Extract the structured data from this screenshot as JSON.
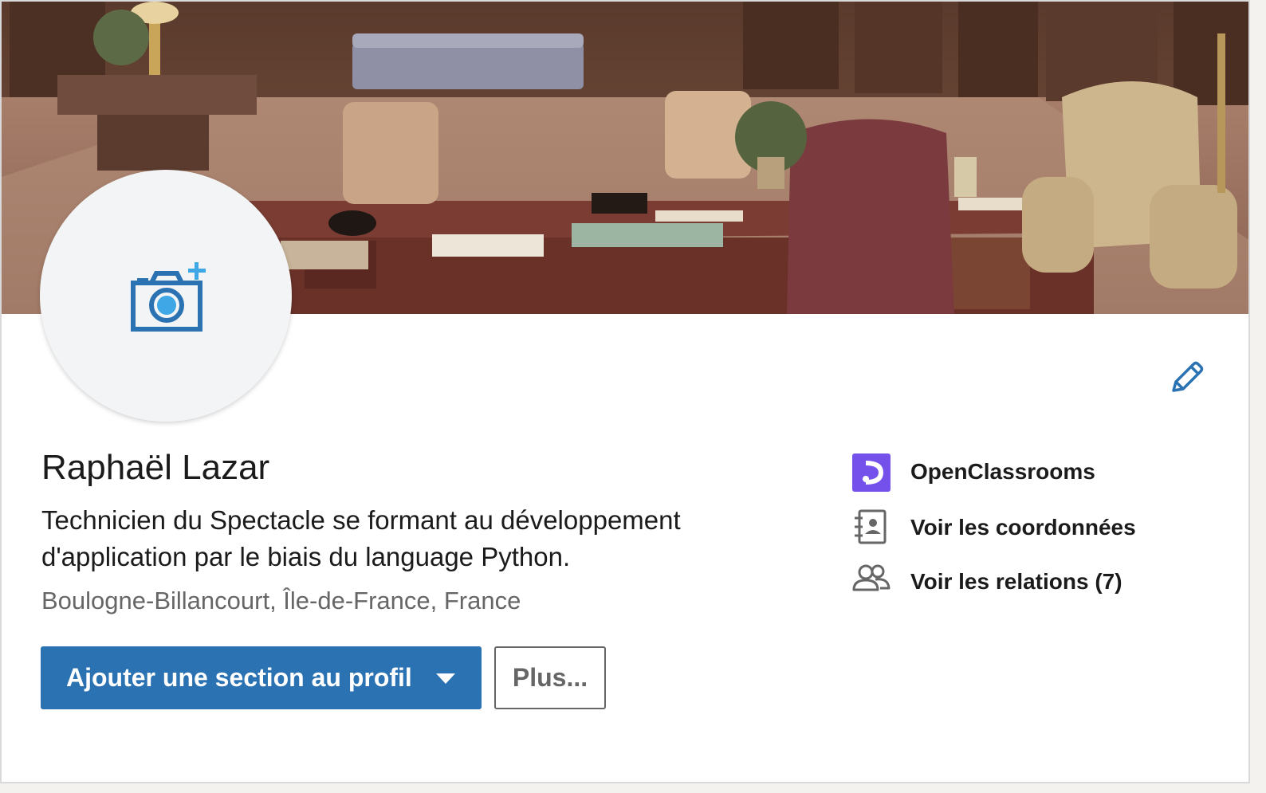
{
  "profile": {
    "name": "Raphaël Lazar",
    "headline": "Technicien du Spectacle se formant au développement d'application par le biais du language Python.",
    "location": "Boulogne-Billancourt, Île-de-France, France"
  },
  "actions": {
    "add_section_label": "Ajouter une section au profil",
    "more_label": "Plus..."
  },
  "sidebar": {
    "items": [
      {
        "label": "OpenClassrooms",
        "icon": "openclassrooms-logo"
      },
      {
        "label": "Voir les coordonnées",
        "icon": "contact-card-icon"
      },
      {
        "label": "Voir les relations (7)",
        "icon": "people-icon"
      }
    ]
  },
  "colors": {
    "primary_blue": "#2b72b3",
    "camera_blue": "#2b72b3",
    "camera_accent": "#3fa7e6",
    "openclassrooms_purple": "#7451eb"
  },
  "icons": {
    "avatar": "camera-add-icon",
    "edit": "pencil-icon",
    "dropdown": "caret-down-icon"
  }
}
